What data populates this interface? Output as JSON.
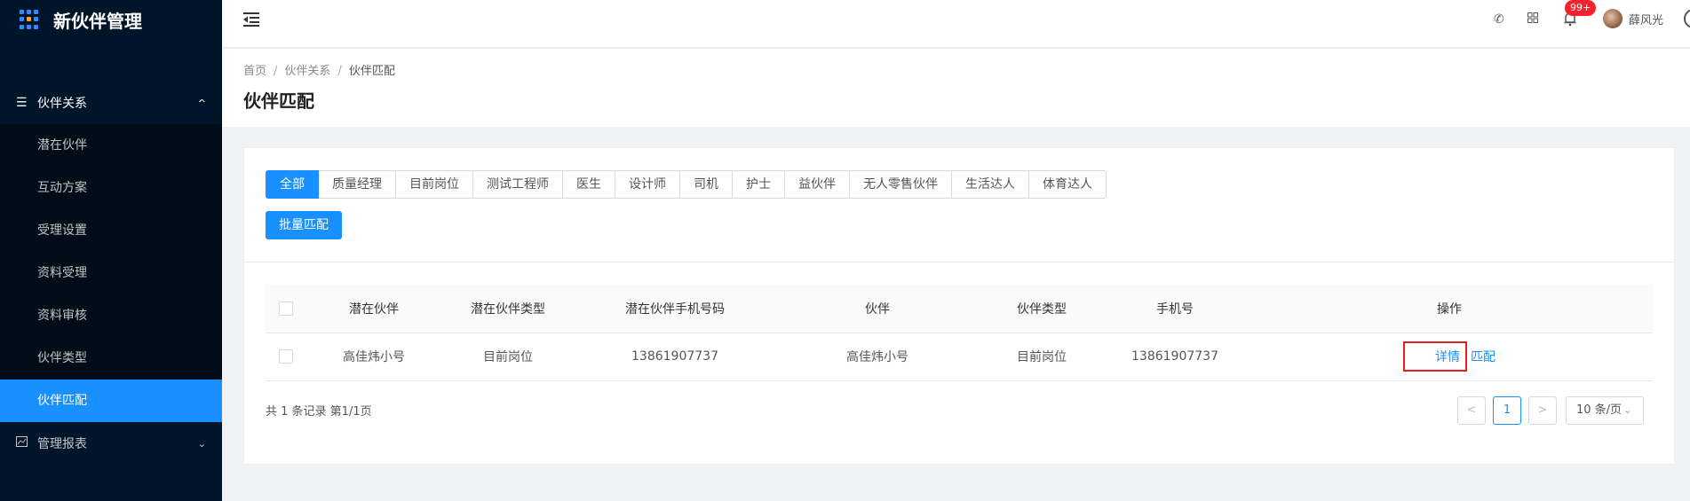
{
  "app": {
    "title": "新伙伴管理"
  },
  "sidebar": {
    "group1": {
      "label": "伙伴关系",
      "icon": "menu-lines-icon",
      "arrow": "^"
    },
    "items": [
      {
        "label": "潜在伙伴"
      },
      {
        "label": "互动方案"
      },
      {
        "label": "受理设置"
      },
      {
        "label": "资料受理"
      },
      {
        "label": "资料审核"
      },
      {
        "label": "伙伴类型"
      },
      {
        "label": "伙伴匹配",
        "active": true
      }
    ],
    "group2": {
      "label": "管理报表",
      "icon": "chart-icon",
      "arrow": "⌄"
    }
  },
  "header": {
    "notifications_badge": "99+",
    "username": "薛风光"
  },
  "breadcrumb": {
    "home": "首页",
    "sep": "/",
    "parent": "伙伴关系",
    "current": "伙伴匹配"
  },
  "page_title": "伙伴匹配",
  "filters": {
    "tabs": [
      "全部",
      "质量经理",
      "目前岗位",
      "测试工程师",
      "医生",
      "设计师",
      "司机",
      "护士",
      "益伙伴",
      "无人零售伙伴",
      "生活达人",
      "体育达人"
    ],
    "active_tab": "全部",
    "batch_button": "批量匹配"
  },
  "table": {
    "columns": [
      "潜在伙伴",
      "潜在伙伴类型",
      "潜在伙伴手机号码",
      "伙伴",
      "伙伴类型",
      "手机号",
      "操作"
    ],
    "rows": [
      {
        "potential": "高佳炜小号",
        "potential_type": "目前岗位",
        "potential_phone": "13861907737",
        "partner": "高佳炜小号",
        "partner_type": "目前岗位",
        "phone": "13861907737",
        "op_detail": "详情",
        "op_match": "匹配"
      }
    ]
  },
  "pagination": {
    "total_text": "共 1 条记录 第1/1页",
    "current_page": "1",
    "prev": "<",
    "next": ">",
    "page_size": "10 条/页"
  },
  "colors": {
    "primary": "#1890ff",
    "sidebar_bg": "#001529",
    "highlight_box": "#e02020"
  }
}
